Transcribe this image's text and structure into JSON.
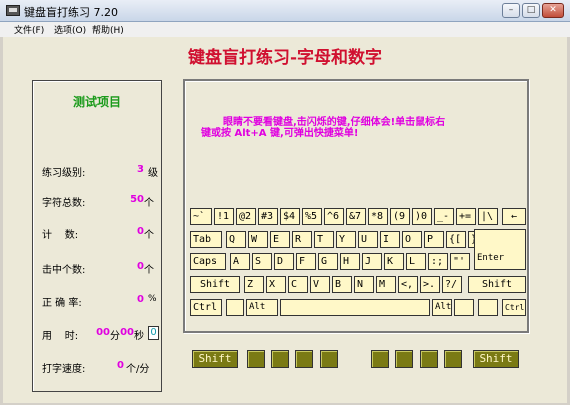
{
  "window": {
    "title": "键盘盲打练习 7.20"
  },
  "menu": [
    {
      "label": "文件(F)"
    },
    {
      "label": "选项(O)"
    },
    {
      "label": "帮助(H)"
    }
  ],
  "heading": "键盘盲打练习-字母和数字",
  "stats": {
    "title": "测试项目",
    "level": {
      "label": "练习级别:",
      "value": "3",
      "unit": "级"
    },
    "total_chars": {
      "label": "字符总数:",
      "value": "50",
      "unit": "个"
    },
    "count": {
      "label": "计    数:",
      "value": "0",
      "unit": "个"
    },
    "hits": {
      "label": "击中个数:",
      "value": "0",
      "unit": "个"
    },
    "accuracy": {
      "label": "正 确 率:",
      "value": "0",
      "unit": "%"
    },
    "time": {
      "label": "用    时:",
      "minutes": "00",
      "min_unit": "分",
      "seconds": "00",
      "sec_unit": "秒",
      "box": "0"
    },
    "speed": {
      "label": "打字速度:",
      "value": "0",
      "unit": "个/分"
    }
  },
  "instruction": {
    "line1": "眼睛不要看键盘,击闪烁的键,仔细体会!单击鼠标右",
    "line2": "键或按 Alt+A 键,可弹出快捷菜单!"
  },
  "keys": {
    "row1": [
      "~`",
      "!1",
      "@2",
      "#3",
      "$4",
      "%5",
      "^6",
      "&7",
      "*8",
      "(9",
      ")0",
      "_-",
      "+=",
      "|\\",
      "←"
    ],
    "row2": [
      "Tab",
      "Q",
      "W",
      "E",
      "R",
      "T",
      "Y",
      "U",
      "I",
      "O",
      "P",
      "{[",
      "}]"
    ],
    "row3": [
      "Caps",
      "A",
      "S",
      "D",
      "F",
      "G",
      "H",
      "J",
      "K",
      "L",
      ":;",
      "\"'",
      "Enter"
    ],
    "row4": [
      "Shift",
      "Z",
      "X",
      "C",
      "V",
      "B",
      "N",
      "M",
      "<,",
      ">.",
      "?/",
      "Shift"
    ],
    "row5": [
      "Ctrl",
      "",
      "Alt",
      "",
      "Alt",
      "",
      "",
      "Ctrl"
    ]
  },
  "fingers": {
    "left_shift": "Shift",
    "right_shift": "Shift"
  }
}
